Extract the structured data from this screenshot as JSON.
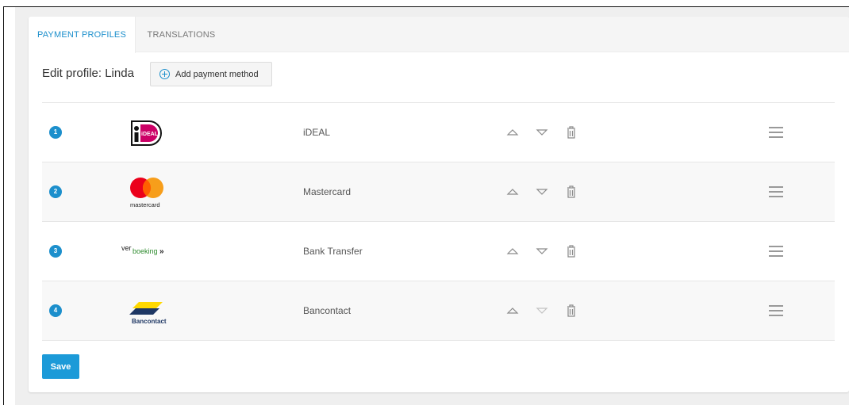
{
  "tabs": [
    {
      "label": "PAYMENT PROFILES",
      "active": true
    },
    {
      "label": "TRANSLATIONS",
      "active": false
    }
  ],
  "profile": {
    "title": "Edit profile: Linda",
    "add_button": "Add payment method"
  },
  "methods": [
    {
      "position": "1",
      "name": "iDEAL",
      "logo": "ideal-logo",
      "logo_text": "iDEAL"
    },
    {
      "position": "2",
      "name": "Mastercard",
      "logo": "mastercard-logo",
      "logo_text": "mastercard"
    },
    {
      "position": "3",
      "name": "Bank Transfer",
      "logo": "overboeking-logo",
      "logo_text_1": "over",
      "logo_text_2": "boeking",
      "logo_text_3": "»"
    },
    {
      "position": "4",
      "name": "Bancontact",
      "logo": "bancontact-logo",
      "logo_text": "Bancontact"
    }
  ],
  "save_label": "Save",
  "colors": {
    "accent": "#1c8fcc",
    "ideal_pink": "#cc0066",
    "mastercard_red": "#eb001b",
    "mastercard_orange": "#f79e1b",
    "overboeking_green": "#2e8b2e",
    "bancontact_blue": "#1e3764",
    "bancontact_yellow": "#ffd800"
  }
}
